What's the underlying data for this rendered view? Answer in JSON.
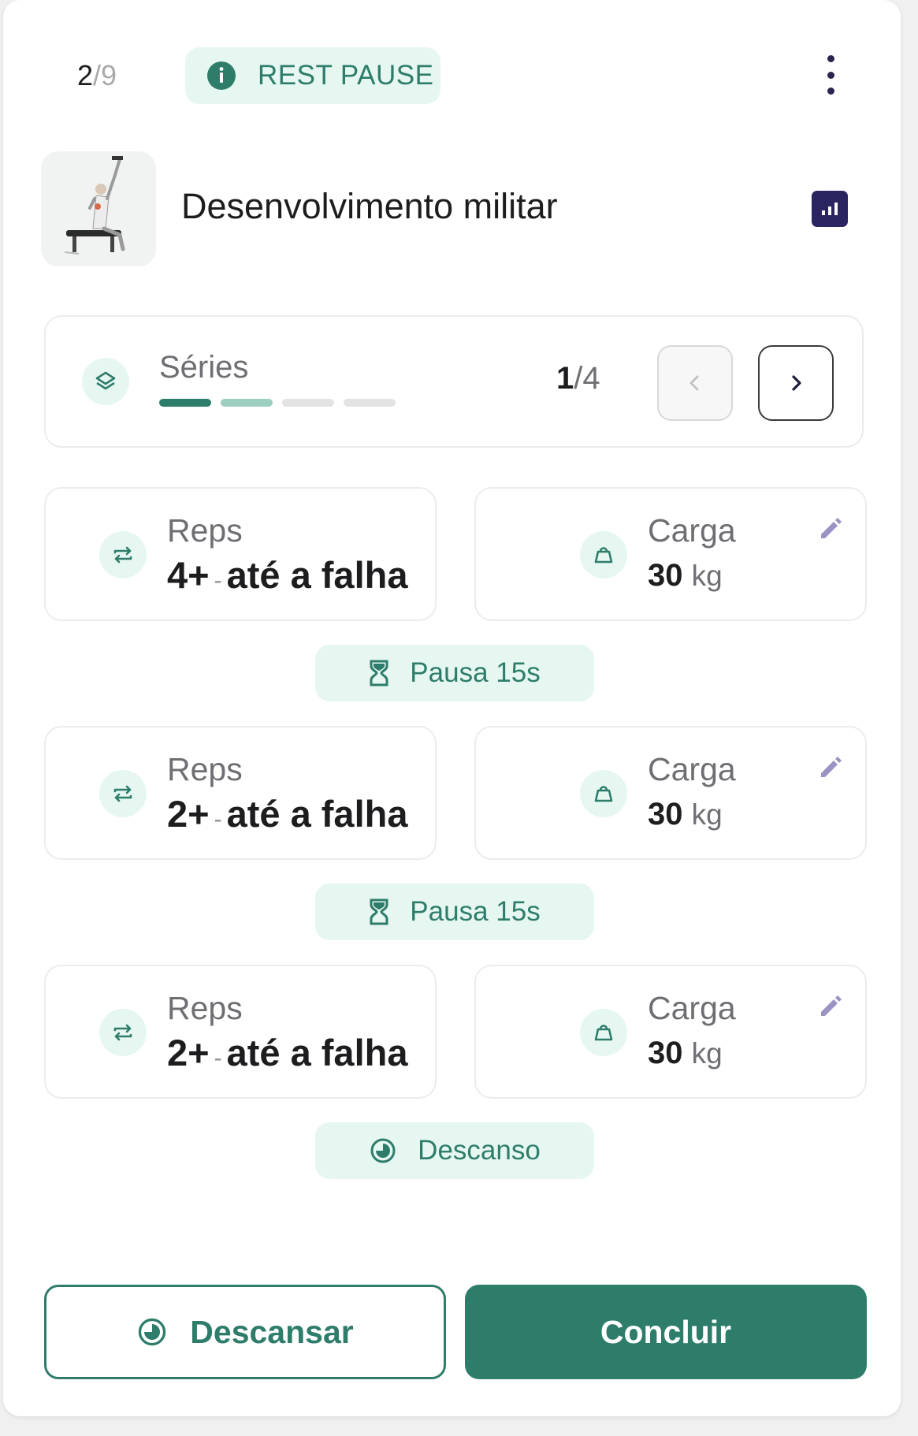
{
  "header": {
    "current": "2",
    "total": "/9",
    "badge_label": "REST PAUSE",
    "menu_icon": "more-vertical-icon"
  },
  "exercise": {
    "title": "Desenvolvimento militar",
    "stats_icon": "stats-chart-icon"
  },
  "series": {
    "label": "Séries",
    "current": "1",
    "total": "/4",
    "progress": [
      {
        "state": "done",
        "color": "#2e7d6b"
      },
      {
        "state": "active",
        "color": "#9ccfc1"
      },
      {
        "state": "pending",
        "color": "#e3e3e3"
      },
      {
        "state": "pending",
        "color": "#e3e3e3"
      }
    ]
  },
  "sets": [
    {
      "reps_label": "Reps",
      "reps_value": "4+",
      "reps_sep": "-",
      "reps_note": "até a falha",
      "load_label": "Carga",
      "load_value": "30",
      "load_unit": "kg"
    },
    {
      "reps_label": "Reps",
      "reps_value": "2+",
      "reps_sep": "-",
      "reps_note": "até a falha",
      "load_label": "Carga",
      "load_value": "30",
      "load_unit": "kg"
    },
    {
      "reps_label": "Reps",
      "reps_value": "2+",
      "reps_sep": "-",
      "reps_note": "até a falha",
      "load_label": "Carga",
      "load_value": "30",
      "load_unit": "kg"
    }
  ],
  "pauses": [
    {
      "label": "Pausa 15s",
      "icon": "hourglass-icon"
    },
    {
      "label": "Pausa 15s",
      "icon": "hourglass-icon"
    },
    {
      "label": "Descanso",
      "icon": "timer-icon"
    }
  ],
  "actions": {
    "rest_label": "Descansar",
    "done_label": "Concluir"
  },
  "colors": {
    "accent": "#2e7d6b",
    "accent_light": "#e6f7f1",
    "stats_button": "#2a2560"
  }
}
